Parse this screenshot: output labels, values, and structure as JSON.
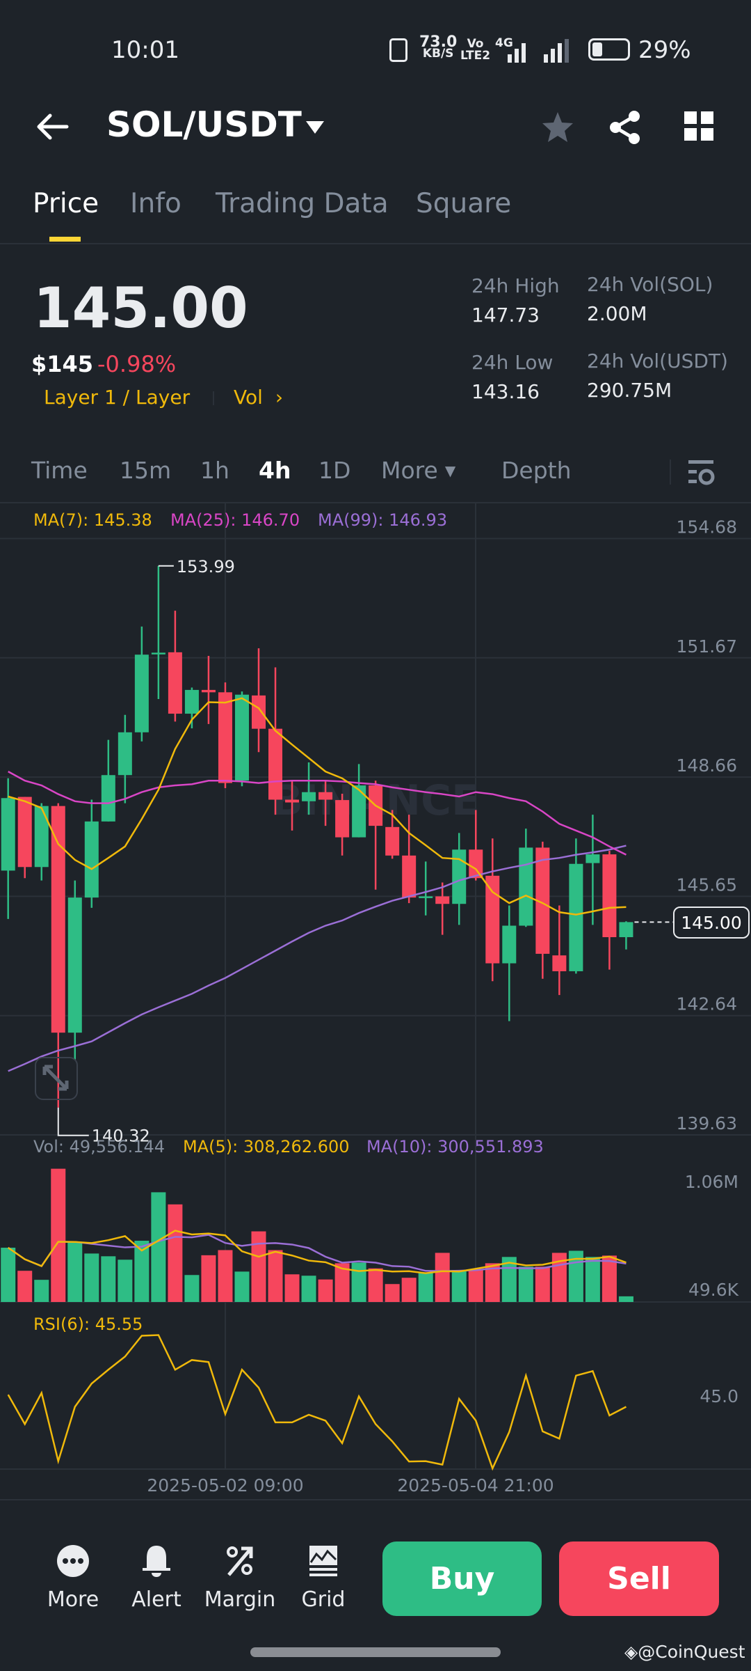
{
  "status_bar": {
    "time": "10:01",
    "net_speed": "73.0",
    "net_unit": "KB/S",
    "volte": "Vo",
    "lte": "LTE2",
    "network": "4G",
    "battery": "29%"
  },
  "header": {
    "pair": "SOL/USDT"
  },
  "tabs": [
    {
      "label": "Price",
      "active": true
    },
    {
      "label": "Info"
    },
    {
      "label": "Trading Data"
    },
    {
      "label": "Square"
    }
  ],
  "ticker": {
    "last_price": "145.00",
    "usd_price": "$145",
    "change": "-0.98%",
    "tag": "Layer 1 / Layer",
    "vol_link": "Vol",
    "high_label": "24h High",
    "high": "147.73",
    "low_label": "24h Low",
    "low": "143.16",
    "vol_sol_label": "24h Vol(SOL)",
    "vol_sol": "2.00M",
    "vol_usdt_label": "24h Vol(USDT)",
    "vol_usdt": "290.75M"
  },
  "intervals": [
    "Time",
    "15m",
    "1h",
    "4h",
    "1D",
    "More",
    "Depth"
  ],
  "active_interval": "4h",
  "legend": {
    "ma7": "MA(7): 145.38",
    "ma25": "MA(25): 146.70",
    "ma99": "MA(99): 146.93",
    "vol": "Vol: 49,556.144",
    "vol_ma5": "MA(5): 308,262.600",
    "vol_ma10": "MA(10): 300,551.893",
    "rsi": "RSI(6): 45.55"
  },
  "current_price_tag": "145.00",
  "high_marker": "153.99",
  "low_marker": "140.32",
  "watermark": "BINANCE",
  "colors": {
    "up": "#2ebd85",
    "down": "#f6465d",
    "ma7": "#f0b90b",
    "ma25": "#d946c6",
    "ma99": "#9b6fd6",
    "accent": "#fcd535"
  },
  "chart_data": {
    "type": "candlestick",
    "title": "SOL/USDT 4h",
    "price_axis": {
      "max": 154.68,
      "min": 139.63,
      "ticks": [
        "154.68",
        "151.67",
        "148.66",
        "145.65",
        "142.64",
        "139.63"
      ]
    },
    "volume_axis": {
      "ticks": [
        "1.06M",
        "49.6K"
      ]
    },
    "rsi_axis": {
      "ticks": [
        "45.0"
      ]
    },
    "x_labels": [
      "2025-05-02 09:00",
      "2025-05-04 21:00"
    ],
    "candles": [
      [
        146.3,
        148.63,
        145.08,
        148.13
      ],
      [
        148.16,
        148.16,
        146.11,
        146.39
      ],
      [
        146.39,
        148.0,
        146.05,
        147.93
      ],
      [
        147.93,
        148.0,
        140.32,
        142.21
      ],
      [
        142.21,
        146.05,
        141.53,
        145.62
      ],
      [
        145.62,
        148.09,
        145.36,
        147.54
      ],
      [
        147.54,
        149.6,
        147.54,
        148.71
      ],
      [
        148.71,
        150.23,
        148.0,
        149.79
      ],
      [
        149.79,
        152.46,
        149.56,
        151.75
      ],
      [
        151.78,
        153.99,
        150.63,
        151.8
      ],
      [
        151.81,
        152.86,
        150.06,
        150.26
      ],
      [
        150.26,
        150.92,
        149.89,
        150.86
      ],
      [
        150.86,
        151.72,
        150.0,
        150.8
      ],
      [
        150.8,
        151.05,
        148.38,
        148.51
      ],
      [
        148.57,
        150.82,
        148.43,
        150.74
      ],
      [
        150.72,
        151.91,
        149.29,
        149.88
      ],
      [
        149.88,
        151.43,
        147.71,
        148.09
      ],
      [
        148.09,
        148.57,
        147.31,
        148.02
      ],
      [
        148.05,
        149.03,
        147.71,
        148.28
      ],
      [
        148.28,
        148.57,
        147.43,
        148.09
      ],
      [
        148.08,
        148.24,
        146.68,
        147.14
      ],
      [
        147.14,
        148.99,
        147.14,
        148.45
      ],
      [
        148.45,
        148.57,
        145.82,
        147.43
      ],
      [
        147.4,
        147.83,
        146.6,
        146.68
      ],
      [
        146.68,
        147.71,
        145.48,
        145.62
      ],
      [
        145.62,
        146.53,
        145.17,
        145.65
      ],
      [
        145.65,
        146.0,
        144.68,
        145.46
      ],
      [
        145.46,
        147.25,
        144.93,
        146.83
      ],
      [
        146.83,
        147.83,
        146.05,
        146.11
      ],
      [
        146.17,
        147.11,
        143.51,
        143.96
      ],
      [
        143.96,
        145.42,
        142.5,
        144.91
      ],
      [
        144.91,
        147.36,
        144.88,
        146.88
      ],
      [
        146.88,
        147.03,
        143.57,
        144.2
      ],
      [
        144.16,
        145.42,
        143.16,
        143.76
      ],
      [
        143.76,
        147.11,
        143.7,
        146.47
      ],
      [
        146.49,
        147.71,
        144.93,
        146.71
      ],
      [
        146.71,
        146.8,
        143.8,
        144.62
      ],
      [
        144.62,
        145.02,
        144.31,
        145.0
      ]
    ],
    "ma7": [
      148.17,
      148.05,
      147.88,
      146.97,
      146.57,
      146.34,
      146.62,
      146.91,
      147.6,
      148.34,
      149.37,
      150.11,
      150.55,
      150.54,
      150.65,
      150.4,
      149.83,
      149.48,
      149.14,
      148.8,
      148.63,
      148.34,
      147.94,
      147.71,
      147.25,
      146.94,
      146.62,
      146.59,
      146.34,
      145.76,
      145.48,
      145.67,
      145.48,
      145.25,
      145.19,
      145.27,
      145.36,
      145.38
    ],
    "ma25": [
      148.8,
      148.57,
      148.45,
      148.23,
      148.05,
      148.0,
      148.0,
      148.11,
      148.28,
      148.4,
      148.45,
      148.48,
      148.57,
      148.57,
      148.55,
      148.51,
      148.55,
      148.57,
      148.57,
      148.57,
      148.55,
      148.51,
      148.48,
      148.4,
      148.34,
      148.28,
      148.23,
      148.17,
      148.28,
      148.23,
      148.13,
      148.05,
      147.79,
      147.48,
      147.31,
      147.14,
      146.91,
      146.7
    ],
    "ma99": [
      141.24,
      141.42,
      141.61,
      141.76,
      141.87,
      141.99,
      142.22,
      142.45,
      142.67,
      142.85,
      143.02,
      143.19,
      143.4,
      143.59,
      143.82,
      144.05,
      144.28,
      144.51,
      144.73,
      144.91,
      145.04,
      145.23,
      145.39,
      145.54,
      145.65,
      145.76,
      145.88,
      146.05,
      146.17,
      146.28,
      146.37,
      146.45,
      146.57,
      146.62,
      146.7,
      146.76,
      146.83,
      146.93
    ],
    "volume": [
      475000,
      273000,
      194000,
      1166000,
      521000,
      424000,
      400000,
      370000,
      536000,
      960000,
      854000,
      236000,
      409000,
      454000,
      266000,
      618000,
      454000,
      242000,
      230000,
      197000,
      339000,
      345000,
      294000,
      157000,
      212000,
      254000,
      430000,
      279000,
      279000,
      339000,
      394000,
      309000,
      309000,
      430000,
      448000,
      394000,
      406000,
      49556
    ],
    "rsi6": [
      49.75,
      39.55,
      50.35,
      26.71,
      45.55,
      53.59,
      58.39,
      62.95,
      70.15,
      70.39,
      58.39,
      61.75,
      61.03,
      43.03,
      58.39,
      52.15,
      40.15,
      40.15,
      42.79,
      40.75,
      32.95,
      49.15,
      39.55,
      33.55,
      26.59,
      26.71,
      25.51,
      48.31,
      40.75,
      24.19,
      36.79,
      56.35,
      37.03,
      34.51,
      56.35,
      57.91,
      42.55,
      45.55
    ]
  },
  "bottom_nav": [
    {
      "label": "More"
    },
    {
      "label": "Alert"
    },
    {
      "label": "Margin"
    },
    {
      "label": "Grid"
    }
  ],
  "buy_label": "Buy",
  "sell_label": "Sell",
  "credit": "@CoinQuest"
}
